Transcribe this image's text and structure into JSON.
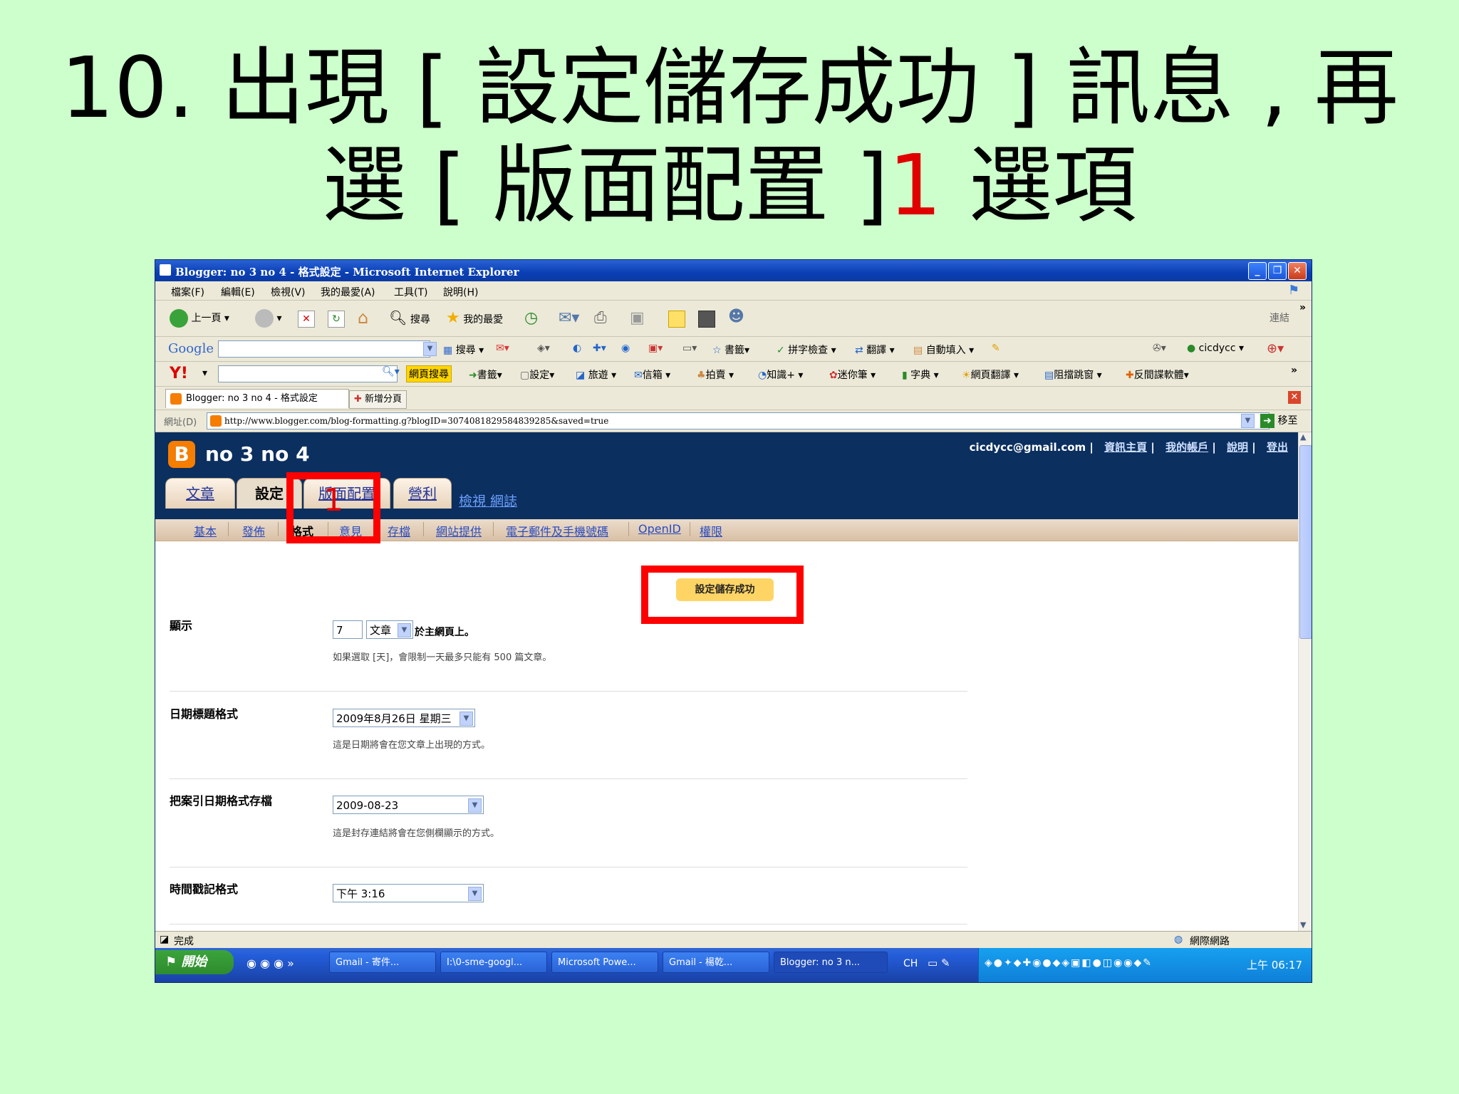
{
  "slide": {
    "line1": "10. 出現 [ 設定儲存成功 ] 訊息 , 再",
    "line2_a": "選 [ 版面配置 ]",
    "line2_num": "1",
    "line2_b": " 選項"
  },
  "window": {
    "title": "Blogger: no 3 no 4 - 格式設定 - Microsoft Internet Explorer",
    "min": "_",
    "max": "❐",
    "close": "✕"
  },
  "menu": [
    "檔案(F)",
    "編輯(E)",
    "檢視(V)",
    "我的最愛(A)",
    "工具(T)",
    "說明(H)"
  ],
  "toolbar": {
    "back": "上一頁",
    "search": "搜尋",
    "favorites": "我的最愛",
    "links": "連結"
  },
  "google_bar": {
    "logo": "Google",
    "search": "搜尋",
    "bookmarks": "書籤",
    "spellcheck": "拼字檢查",
    "translate": "翻譯",
    "autofill": "自動填入",
    "account": "cicdycc"
  },
  "yahoo_bar": {
    "logo": "Y!",
    "web_search": "網頁搜尋",
    "items": [
      "書籤",
      "設定",
      "旅遊",
      "信箱",
      "拍賣",
      "知識+",
      "迷你筆",
      "字典",
      "網頁翻譯",
      "阻擋跳窗",
      "反間諜軟體"
    ]
  },
  "tabs": {
    "active": "Blogger: no 3 no 4 - 格式設定",
    "new_tab": "新增分頁"
  },
  "address": {
    "label": "網址(D)",
    "url": "http://www.blogger.com/blog-formatting.g?blogID=3074081829584839285&saved=true",
    "go": "移至"
  },
  "blogger": {
    "logo": "B",
    "blog_name": "no 3 no 4",
    "user": "cicdycc@gmail.com",
    "links": [
      "資訊主頁",
      "我的帳戶",
      "說明",
      "登出"
    ],
    "tabs": [
      "文章",
      "設定",
      "版面配置",
      "營利"
    ],
    "view_blog": "檢視 網誌",
    "subnav": [
      "基本",
      "發佈",
      "格式",
      "意見",
      "存檔",
      "網站提供",
      "電子郵件及手機號碼",
      "OpenID",
      "權限"
    ],
    "saved_msg": "設定儲存成功",
    "marker_num": "1"
  },
  "settings": {
    "show": {
      "label": "顯示",
      "count": "7",
      "unit": "文章",
      "suffix": "於主網頁上。",
      "hint": "如果選取 [天]，會限制一天最多只能有 500 篇文章。"
    },
    "date_header": {
      "label": "日期標題格式",
      "value": "2009年8月26日 星期三",
      "hint": "這是日期將會在您文章上出現的方式。"
    },
    "archive_date": {
      "label": "把案引日期格式存檔",
      "value": "2009-08-23",
      "hint": "這是封存連結將會在您側欄顯示的方式。"
    },
    "timestamp": {
      "label": "時間戳記格式",
      "value": "下午 3:16"
    }
  },
  "status": {
    "text": "完成",
    "zone": "網際網路"
  },
  "taskbar": {
    "start": "開始",
    "tasks": [
      "Gmail - 寄件...",
      "I:\\0-sme-googl...",
      "Microsoft Powe...",
      "Gmail - 楊乾...",
      "Blogger: no 3 n..."
    ],
    "lang": "CH",
    "clock": "上午 06:17"
  },
  "colors": {
    "accent_red": "#ff0000",
    "blogger_blue": "#0b2f5f",
    "saved_yellow": "#fed565",
    "slide_bg": "#ccffcc"
  }
}
